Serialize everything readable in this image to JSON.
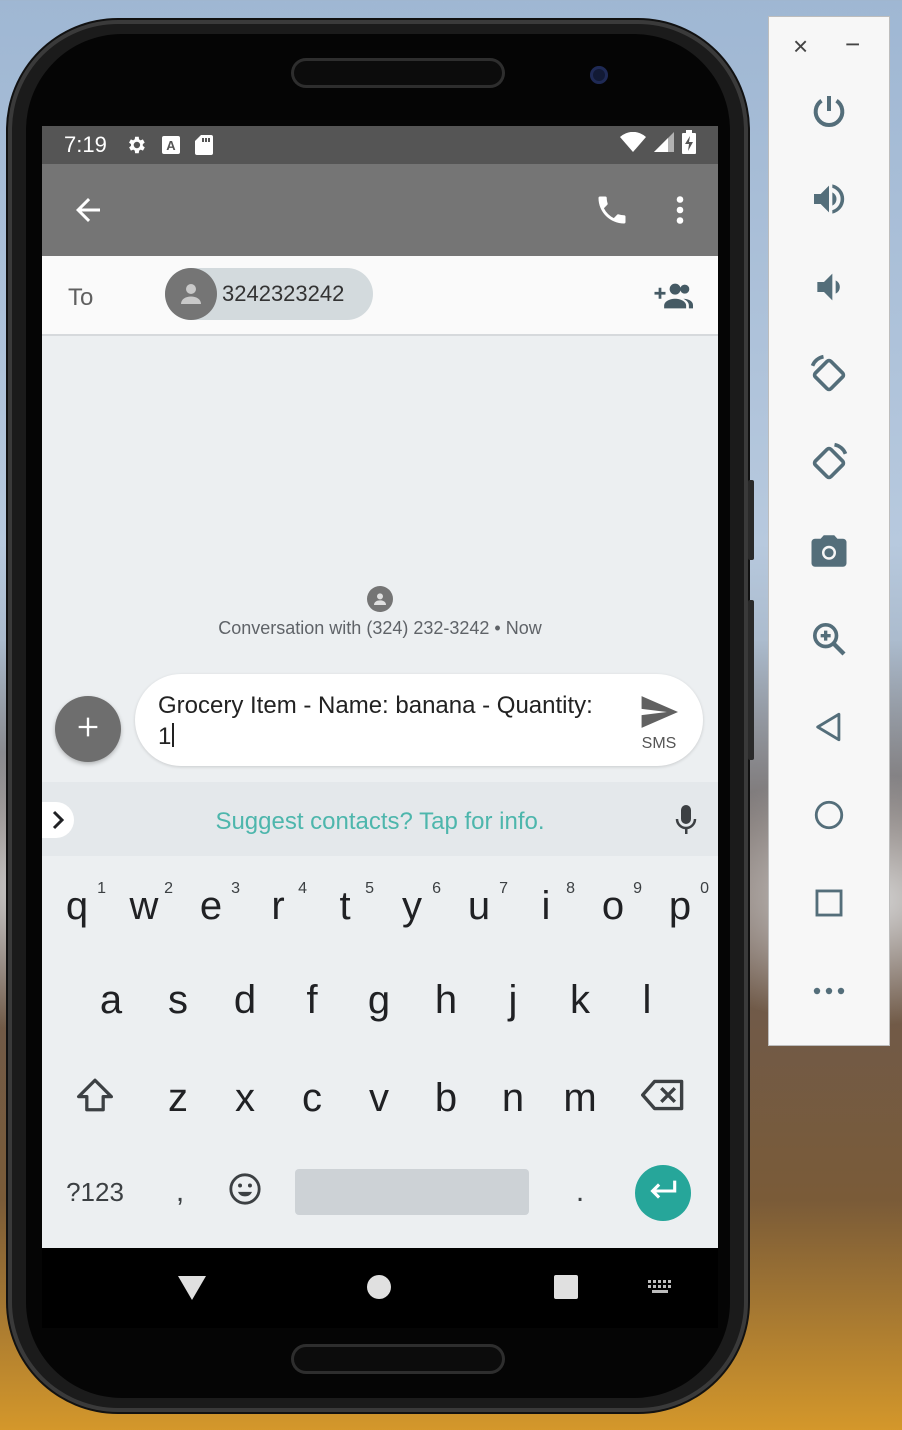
{
  "status_bar": {
    "time": "7:19",
    "icons": [
      "settings-icon",
      "font-a-icon",
      "sd-card-icon",
      "wifi-icon",
      "signal-icon",
      "battery-charging-icon"
    ]
  },
  "app_bar": {
    "back_icon": "arrow-back-icon",
    "call_icon": "phone-icon",
    "more_icon": "more-vert-icon"
  },
  "recipient": {
    "to_label": "To",
    "chip_number": "3242323242",
    "add_icon": "add-people-icon"
  },
  "conversation": {
    "info_text": "Conversation with (324) 232-3242 • Now"
  },
  "compose": {
    "attach_icon": "plus-icon",
    "message_line1": "Grocery Item - Name: banana - Quantity:",
    "message_line2": "1",
    "send_label": "SMS",
    "send_icon": "send-icon"
  },
  "suggestions": {
    "text": "Suggest contacts? Tap for info.",
    "expand_icon": "chevron-right-icon",
    "mic_icon": "mic-icon"
  },
  "keyboard": {
    "row1": [
      {
        "key": "q",
        "hint": "1"
      },
      {
        "key": "w",
        "hint": "2"
      },
      {
        "key": "e",
        "hint": "3"
      },
      {
        "key": "r",
        "hint": "4"
      },
      {
        "key": "t",
        "hint": "5"
      },
      {
        "key": "y",
        "hint": "6"
      },
      {
        "key": "u",
        "hint": "7"
      },
      {
        "key": "i",
        "hint": "8"
      },
      {
        "key": "o",
        "hint": "9"
      },
      {
        "key": "p",
        "hint": "0"
      }
    ],
    "row2": [
      "a",
      "s",
      "d",
      "f",
      "g",
      "h",
      "j",
      "k",
      "l"
    ],
    "row3": [
      "z",
      "x",
      "c",
      "v",
      "b",
      "n",
      "m"
    ],
    "symbols_label": "?123",
    "comma": ",",
    "period": ".",
    "shift_icon": "shift-icon",
    "backspace_icon": "backspace-icon",
    "emoji_icon": "emoji-icon",
    "enter_icon": "enter-icon",
    "enter_color": "#26a69a"
  },
  "nav_bar": {
    "back_icon": "nav-back-triangle-icon",
    "home_icon": "nav-home-circle-icon",
    "recents_icon": "nav-recents-square-icon",
    "keyboard_icon": "keyboard-icon"
  },
  "emulator_toolbar": {
    "close": "×",
    "minimize": "−",
    "buttons": [
      "power-icon",
      "volume-up-icon",
      "volume-down-icon",
      "rotate-left-icon",
      "rotate-right-icon",
      "camera-icon",
      "zoom-icon",
      "back-icon",
      "home-icon",
      "overview-icon",
      "more-icon"
    ]
  },
  "colors": {
    "app_bar": "#757575",
    "status_bar": "#555555",
    "accent_teal": "#4db6ac",
    "toolbar_icon": "#546e7a"
  }
}
